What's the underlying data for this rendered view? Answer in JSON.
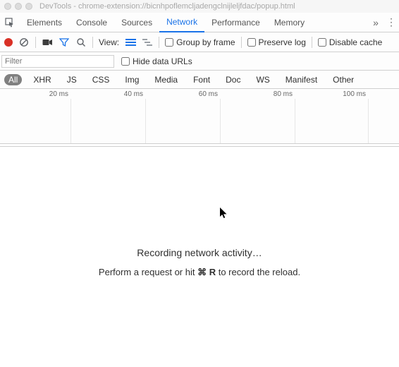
{
  "window": {
    "title": "DevTools - chrome-extension://bicnhpoflemcljadengclnijleljfdac/popup.html"
  },
  "tabs": {
    "items": [
      "Elements",
      "Console",
      "Sources",
      "Network",
      "Performance",
      "Memory"
    ],
    "active_index": 3
  },
  "toolbar": {
    "view_label": "View:",
    "group_by_frame": "Group by frame",
    "preserve_log": "Preserve log",
    "disable_cache": "Disable cache"
  },
  "filter": {
    "placeholder": "Filter",
    "hide_data_urls": "Hide data URLs"
  },
  "types": {
    "items": [
      "All",
      "XHR",
      "JS",
      "CSS",
      "Img",
      "Media",
      "Font",
      "Doc",
      "WS",
      "Manifest",
      "Other"
    ],
    "active_index": 0
  },
  "timeline": {
    "ticks": [
      "20 ms",
      "40 ms",
      "60 ms",
      "80 ms",
      "100 ms"
    ]
  },
  "body": {
    "recording": "Recording network activity…",
    "hint_prefix": "Perform a request or hit ",
    "hint_key": "⌘ R",
    "hint_suffix": " to record the reload."
  }
}
